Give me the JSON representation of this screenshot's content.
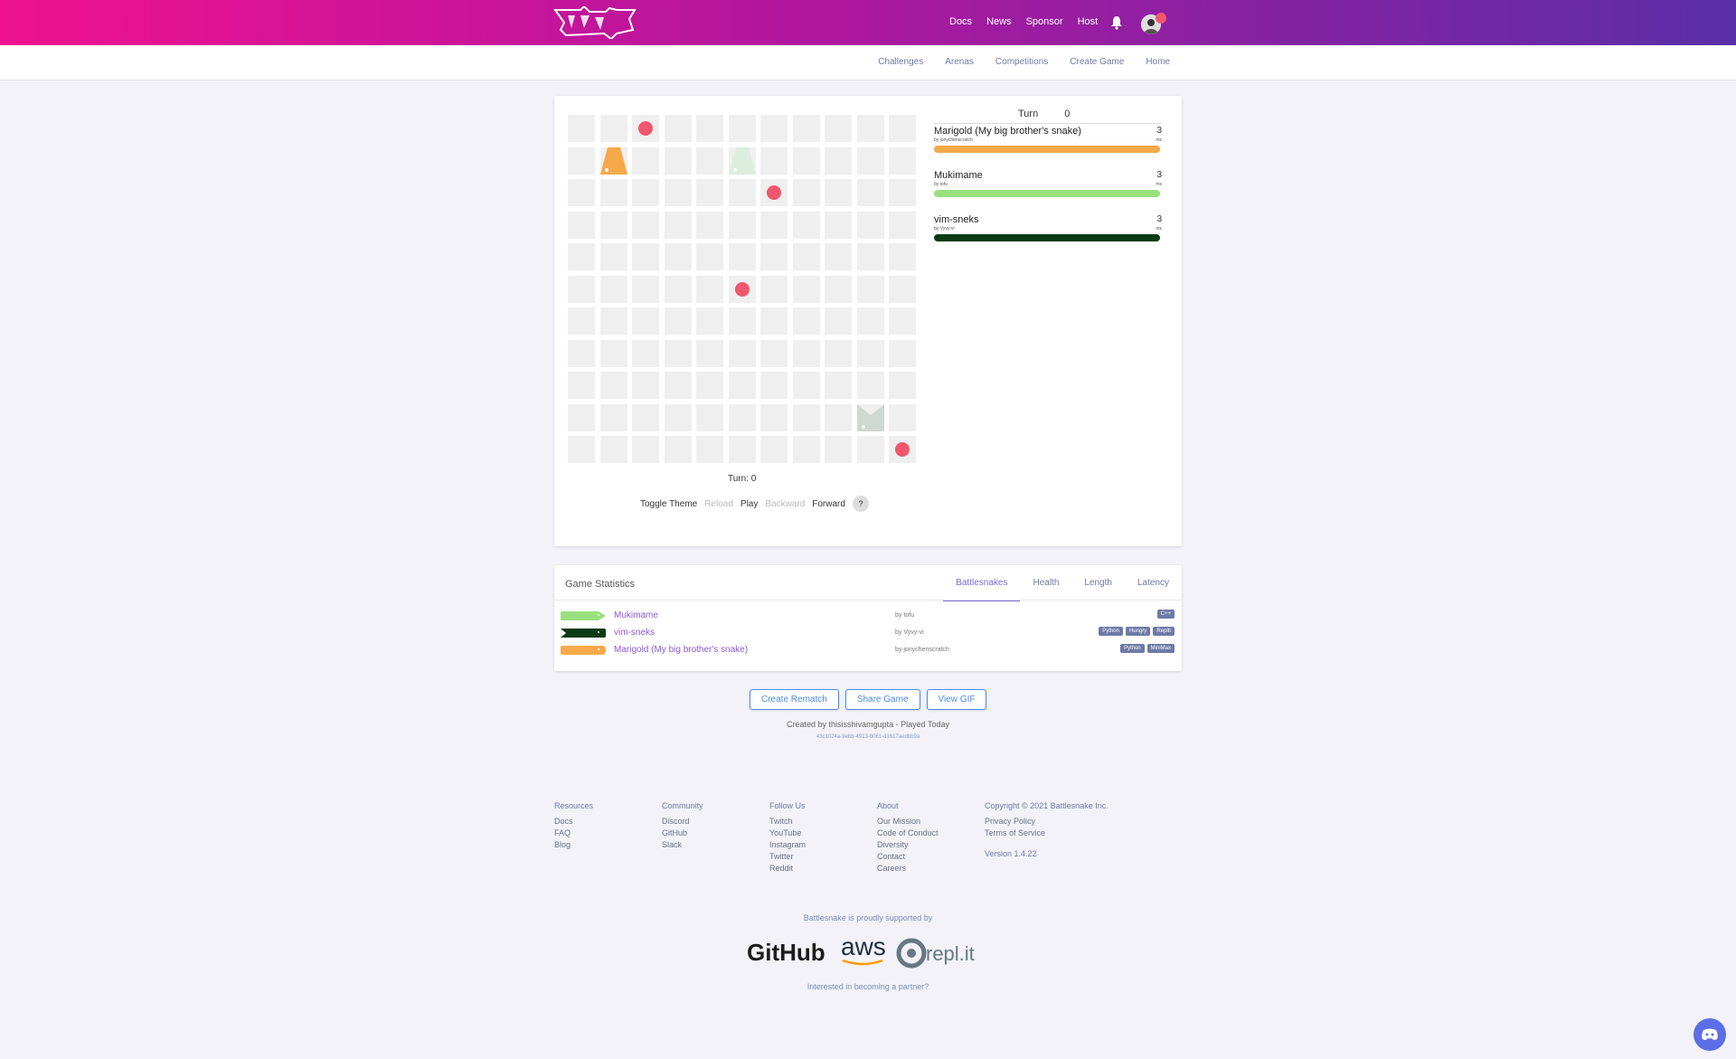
{
  "header": {
    "nav": [
      "Docs",
      "News",
      "Sponsor",
      "Host"
    ]
  },
  "subnav": [
    "Challenges",
    "Arenas",
    "Competitions",
    "Create Game",
    "Home"
  ],
  "board": {
    "food": [
      [
        2,
        0
      ],
      [
        6,
        2
      ],
      [
        5,
        5
      ],
      [
        10,
        10
      ]
    ],
    "turn_label": "Turn: 0",
    "controls": {
      "toggle_theme": "Toggle Theme",
      "reload": "Reload",
      "play": "Play",
      "backward": "Backward",
      "forward": "Forward",
      "help": "?"
    }
  },
  "scoreboard": {
    "turn_label": "Turn",
    "turn_value": "0",
    "snakes": [
      {
        "name": "Marigold (My big brother's snake)",
        "author": "by jonychenscratch",
        "length": "3",
        "unit": "ms",
        "color": "#f5a94a"
      },
      {
        "name": "Mukimame",
        "author": "by tofu",
        "length": "3",
        "unit": "ms",
        "color": "#9ae07e"
      },
      {
        "name": "vim-sneks",
        "author": "by Vyvy-vi",
        "length": "3",
        "unit": "ms",
        "color": "#0b3b16"
      }
    ]
  },
  "stats": {
    "title": "Game Statistics",
    "tabs": [
      "Battlesnakes",
      "Health",
      "Length",
      "Latency"
    ],
    "rows": [
      {
        "name": "Mukimame",
        "author": "by tofu",
        "tags": [
          "C++"
        ],
        "color": "#9ae07e"
      },
      {
        "name": "vim-sneks",
        "author": "by Vyvy-vi",
        "tags": [
          "Python",
          "Hungry",
          "ReplIt"
        ],
        "color": "#0b3b16"
      },
      {
        "name": "Marigold (My big brother's snake)",
        "author": "by jonychenscratch",
        "tags": [
          "Python",
          "MiniMax"
        ],
        "color": "#f5a94a"
      }
    ]
  },
  "actions": {
    "rematch": "Create Rematch",
    "share": "Share Game",
    "gif": "View GIF"
  },
  "meta": {
    "created": "Created by thisisshivamgupta - Played Today",
    "game_id": "43c1024a-9ebb-4913-8061-d1617aedbb9a"
  },
  "footer": {
    "resources": {
      "title": "Resources",
      "items": [
        "Docs",
        "FAQ",
        "Blog"
      ]
    },
    "community": {
      "title": "Community",
      "items": [
        "Discord",
        "GitHub",
        "Slack"
      ]
    },
    "follow": {
      "title": "Follow Us",
      "items": [
        "Twitch",
        "YouTube",
        "Instagram",
        "Twitter",
        "Reddit"
      ]
    },
    "about": {
      "title": "About",
      "items": [
        "Our Mission",
        "Code of Conduct",
        "Diversity",
        "Contact",
        "Careers"
      ]
    },
    "copyright": "Copyright © 2021 Battlesnake Inc.",
    "legal": [
      "Privacy Policy",
      "Terms of Service"
    ],
    "version": "Version 1.4.22"
  },
  "sponsors": {
    "supported": "Battlesnake is proudly supported by",
    "github": "GitHub",
    "aws": "aws",
    "replit": "repl.it",
    "partner": "Interested in becoming a partner?"
  }
}
